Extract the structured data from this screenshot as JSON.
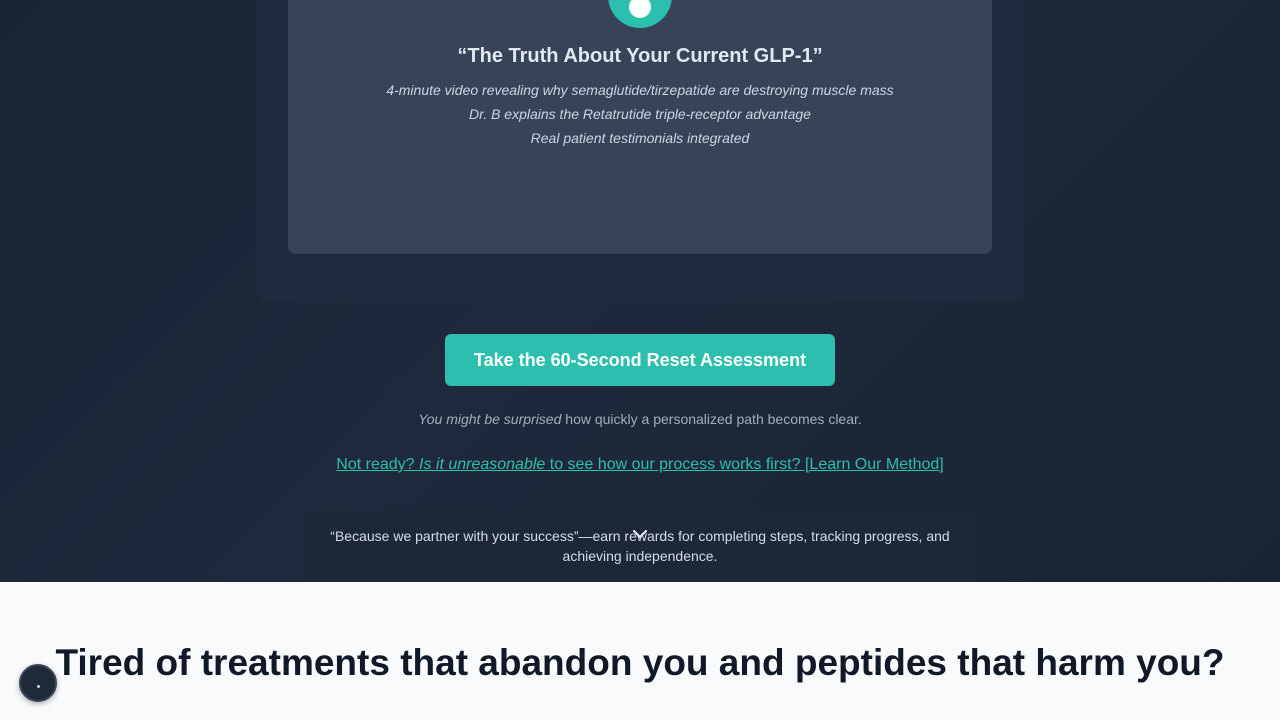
{
  "video": {
    "title": "“The Truth About Your Current GLP-1”",
    "lines": [
      "4-minute video revealing why semaglutide/tirzepatide are destroying muscle mass",
      "Dr. B explains the Retatrutide triple-receptor advantage",
      "Real patient testimonials integrated"
    ]
  },
  "cta": {
    "button_label": "Take the 60-Second Reset Assessment",
    "sub_em": "You might be surprised",
    "sub_rest": " how quickly a personalized path becomes clear."
  },
  "method_link": {
    "part1": "Not ready? ",
    "part_em": "Is it unreasonable",
    "part2": " to see how our process works first? [Learn Our Method]"
  },
  "partner": {
    "text": "“Because we partner with your success”—earn rewards for completing steps, tracking progress, and achieving independence."
  },
  "section": {
    "heading": "Tired of treatments that abandon you and peptides that harm you?"
  },
  "colors": {
    "accent": "#2cbfae",
    "hero_bg": "#1e293b",
    "light_bg": "#f8fafc"
  }
}
